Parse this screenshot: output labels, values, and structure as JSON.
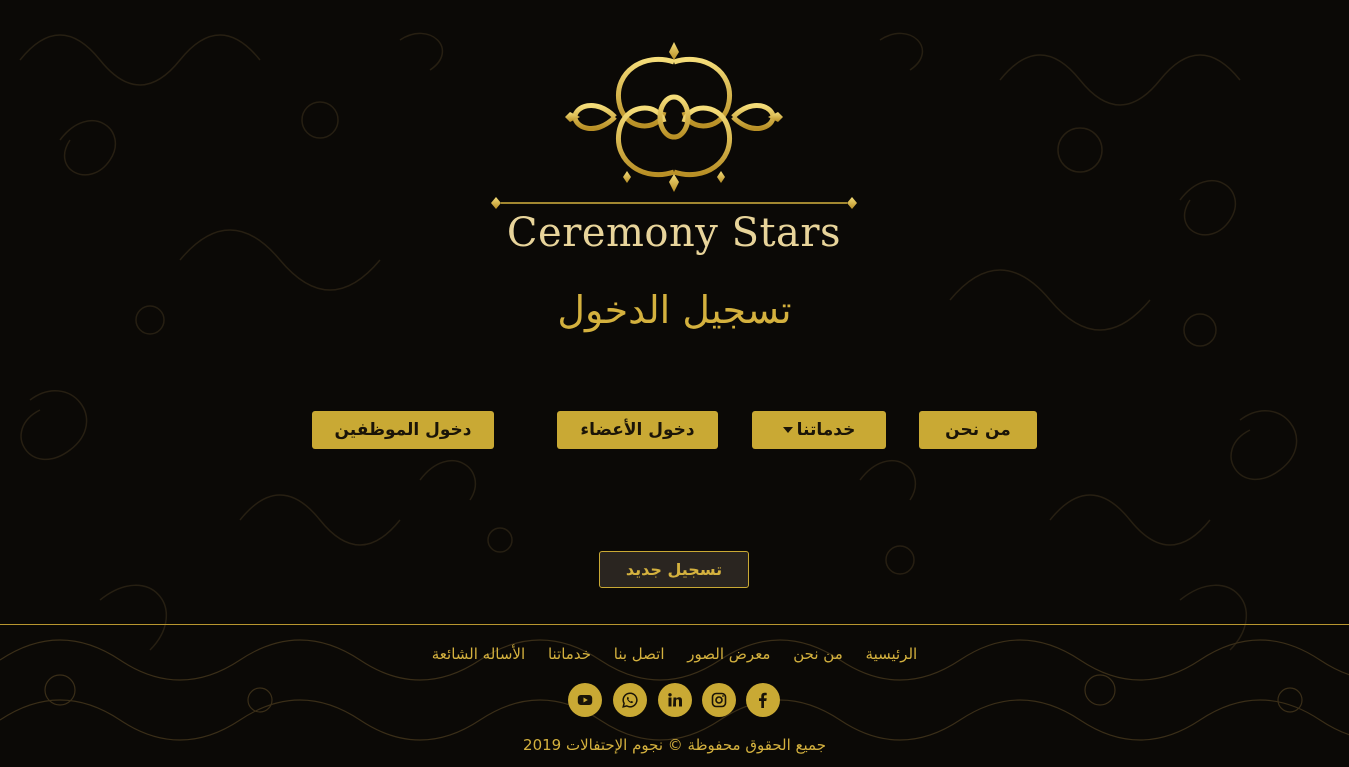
{
  "brand": {
    "logo_text": "Ceremony Stars"
  },
  "page": {
    "title": "تسجيل الدخول"
  },
  "nav_buttons": {
    "about": "من نحن",
    "services": "خدماتنا",
    "members_login": "دخول الأعضاء",
    "staff_login": "دخول الموظفين"
  },
  "register_button": "تسجيل جديد",
  "footer": {
    "links": [
      "الرئيسية",
      "من نحن",
      "معرض الصور",
      "اتصل بنا",
      "خدماتنا",
      "الأساله الشائعة"
    ],
    "social": [
      "facebook-icon",
      "instagram-icon",
      "linkedin-icon",
      "whatsapp-icon",
      "youtube-icon"
    ],
    "copyright": "جميع الحقوق محفوظة © نجوم الإحتفالات 2019"
  },
  "colors": {
    "gold": "#c9a934",
    "background": "#0b0906",
    "text_gold": "#d4b13e"
  }
}
